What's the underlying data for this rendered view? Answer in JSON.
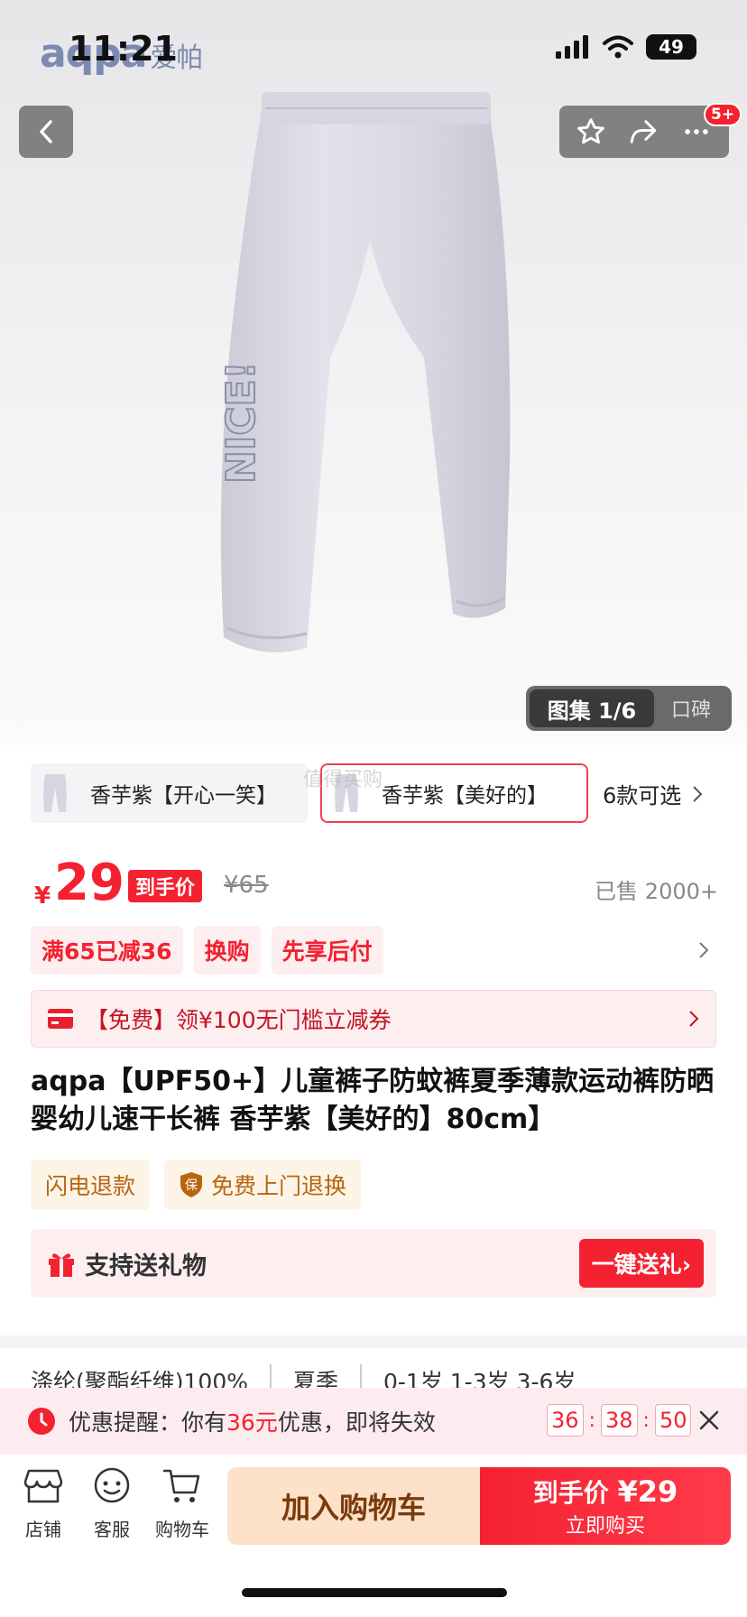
{
  "status_bar": {
    "time": "11:21",
    "battery": "49"
  },
  "brand": {
    "latin": "aqpa",
    "cn": "爱帕"
  },
  "header": {
    "cart_badge": "5+"
  },
  "gallery": {
    "active_label": "图集 1/6",
    "other_label": "口碑"
  },
  "variants": {
    "items": [
      {
        "label": "香芋紫【开心一笑】"
      },
      {
        "label": "香芋紫【美好的】"
      }
    ],
    "more_label": "6款可选",
    "watermark": "值得买购"
  },
  "price": {
    "symbol": "¥",
    "value": "29",
    "tag": "到手价",
    "original": "¥65",
    "sold": "已售 2000+"
  },
  "promos": [
    "满65已减36",
    "换购",
    "先享后付"
  ],
  "coupon": {
    "label": "【免费】领¥100无门槛立减券"
  },
  "product": {
    "title": "aqpa【UPF50+】儿童裤子防蚊裤夏季薄款运动裤防晒婴幼儿速干长裤 香芋紫【美好的】80cm】"
  },
  "services": [
    {
      "label": "闪电退款",
      "icon": ""
    },
    {
      "label": "免费上门退换",
      "icon": "保"
    }
  ],
  "gift": {
    "label": "支持送礼物",
    "button": "一键送礼›"
  },
  "specs": [
    "涤纶(聚酯纤维)100%",
    "夏季",
    "0-1岁 1-3岁 3-6岁"
  ],
  "reminder": {
    "prefix": "优惠提醒：你有",
    "amount": "36元",
    "suffix": "优惠，即将失效",
    "countdown": [
      "36",
      "38",
      "50"
    ]
  },
  "bottom_nav": [
    {
      "label": "店铺",
      "icon": "store-icon"
    },
    {
      "label": "客服",
      "icon": "customer-service-icon"
    },
    {
      "label": "购物车",
      "icon": "cart-icon"
    }
  ],
  "actions": {
    "add_to_cart": "加入购物车",
    "buy_top": "到手价",
    "buy_amount": "¥29",
    "buy_bottom": "立即购买"
  },
  "colors": {
    "accent": "#f42130",
    "cart_bg": "#fde1c8",
    "service_text": "#b8650e"
  }
}
